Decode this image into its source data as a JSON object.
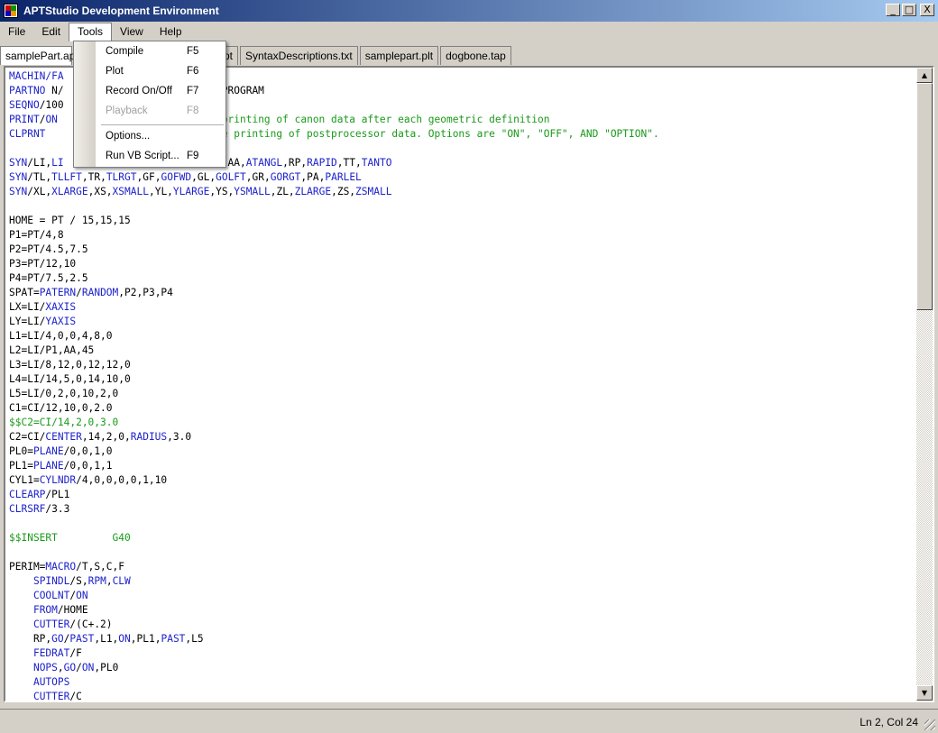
{
  "window": {
    "title": "APTStudio Development Environment",
    "min": "_",
    "max": "□",
    "close": "X"
  },
  "menu": [
    "File",
    "Edit",
    "Tools",
    "View",
    "Help"
  ],
  "tabs": [
    "samplePart.apt",
    "pt",
    "SyntaxDescriptions.txt",
    "samplepart.plt",
    "dogbone.tap"
  ],
  "tools_menu": {
    "items": [
      {
        "label": "Compile",
        "shortcut": "F5",
        "enabled": true
      },
      {
        "label": "Plot",
        "shortcut": "F6",
        "enabled": true
      },
      {
        "label": "Record On/Off",
        "shortcut": "F7",
        "enabled": true
      },
      {
        "label": "Playback",
        "shortcut": "F8",
        "enabled": false
      },
      {
        "label": "Options...",
        "shortcut": "",
        "enabled": true
      },
      {
        "label": "Run VB Script...",
        "shortcut": "F9",
        "enabled": true
      }
    ]
  },
  "colors": {
    "keyword": "#1d22c9",
    "comment": "#1a9a1a",
    "text": "#000000"
  },
  "code_lines": [
    [
      [
        "MACHIN/FA",
        "k"
      ]
    ],
    [
      [
        "PARTNO",
        "k"
      ],
      [
        " N/",
        ""
      ],
      [
        "                          PROGRAM",
        ""
      ]
    ],
    [
      [
        "SEQNO",
        "k"
      ],
      [
        "/100",
        ""
      ]
    ],
    [
      [
        "PRINT",
        "k"
      ],
      [
        "/",
        ""
      ],
      [
        "ON",
        "k"
      ],
      [
        "                       ",
        ""
      ],
      [
        "the printing of canon data after each geometric definition",
        "c"
      ]
    ],
    [
      [
        "CLPRNT",
        "k"
      ],
      [
        "                           ",
        ""
      ],
      [
        "the printing of postprocessor data. Options are \"ON\", \"OFF\", AND \"OPTION\".",
        "c"
      ]
    ],
    [
      [
        "",
        ""
      ]
    ],
    [
      [
        "SYN",
        "k"
      ],
      [
        "/LI,",
        ""
      ],
      [
        "LI",
        "k"
      ],
      [
        "                           AA,",
        ""
      ],
      [
        "ATANGL",
        "k"
      ],
      [
        ",RP,",
        ""
      ],
      [
        "RAPID",
        "k"
      ],
      [
        ",TT,",
        ""
      ],
      [
        "TANTO",
        "k"
      ]
    ],
    [
      [
        "SYN",
        "k"
      ],
      [
        "/TL,",
        ""
      ],
      [
        "TLLFT",
        "k"
      ],
      [
        ",TR,",
        ""
      ],
      [
        "TLRGT",
        "k"
      ],
      [
        ",GF,",
        ""
      ],
      [
        "GOFWD",
        "k"
      ],
      [
        ",GL,",
        ""
      ],
      [
        "GOLFT",
        "k"
      ],
      [
        ",GR,",
        ""
      ],
      [
        "GORGT",
        "k"
      ],
      [
        ",PA,",
        ""
      ],
      [
        "PARLEL",
        "k"
      ]
    ],
    [
      [
        "SYN",
        "k"
      ],
      [
        "/XL,",
        ""
      ],
      [
        "XLARGE",
        "k"
      ],
      [
        ",XS,",
        ""
      ],
      [
        "XSMALL",
        "k"
      ],
      [
        ",YL,",
        ""
      ],
      [
        "YLARGE",
        "k"
      ],
      [
        ",YS,",
        ""
      ],
      [
        "YSMALL",
        "k"
      ],
      [
        ",ZL,",
        ""
      ],
      [
        "ZLARGE",
        "k"
      ],
      [
        ",ZS,",
        ""
      ],
      [
        "ZSMALL",
        "k"
      ]
    ],
    [
      [
        "",
        ""
      ]
    ],
    [
      [
        "HOME = PT / 15,15,15",
        ""
      ]
    ],
    [
      [
        "P1=PT/4,8",
        ""
      ]
    ],
    [
      [
        "P2=PT/4.5,7.5",
        ""
      ]
    ],
    [
      [
        "P3=PT/12,10",
        ""
      ]
    ],
    [
      [
        "P4=PT/7.5,2.5",
        ""
      ]
    ],
    [
      [
        "SPAT=",
        ""
      ],
      [
        "PATERN",
        "k"
      ],
      [
        "/",
        ""
      ],
      [
        "RANDOM",
        "k"
      ],
      [
        ",P2,P3,P4",
        ""
      ]
    ],
    [
      [
        "LX=LI/",
        ""
      ],
      [
        "XAXIS",
        "k"
      ]
    ],
    [
      [
        "LY=LI/",
        ""
      ],
      [
        "YAXIS",
        "k"
      ]
    ],
    [
      [
        "L1=LI/4,0,0,4,8,0",
        ""
      ]
    ],
    [
      [
        "L2=LI/P1,AA,45",
        ""
      ]
    ],
    [
      [
        "L3=LI/8,12,0,12,12,0",
        ""
      ]
    ],
    [
      [
        "L4=LI/14,5,0,14,10,0",
        ""
      ]
    ],
    [
      [
        "L5=LI/0,2,0,10,2,0",
        ""
      ]
    ],
    [
      [
        "C1=CI/12,10,0,2.0",
        ""
      ]
    ],
    [
      [
        "$$C2=CI/14,2,0,3.0",
        "c"
      ]
    ],
    [
      [
        "C2=CI/",
        ""
      ],
      [
        "CENTER",
        "k"
      ],
      [
        ",14,2,0,",
        ""
      ],
      [
        "RADIUS",
        "k"
      ],
      [
        ",3.0",
        ""
      ]
    ],
    [
      [
        "PL0=",
        ""
      ],
      [
        "PLANE",
        "k"
      ],
      [
        "/0,0,1,0",
        ""
      ]
    ],
    [
      [
        "PL1=",
        ""
      ],
      [
        "PLANE",
        "k"
      ],
      [
        "/0,0,1,1",
        ""
      ]
    ],
    [
      [
        "CYL1=",
        ""
      ],
      [
        "CYLNDR",
        "k"
      ],
      [
        "/4,0,0,0,0,1,10",
        ""
      ]
    ],
    [
      [
        "CLEARP",
        "k"
      ],
      [
        "/PL1",
        ""
      ]
    ],
    [
      [
        "CLRSRF",
        "k"
      ],
      [
        "/3.3",
        ""
      ]
    ],
    [
      [
        "",
        ""
      ]
    ],
    [
      [
        "$$INSERT         G40",
        "c"
      ]
    ],
    [
      [
        "",
        ""
      ]
    ],
    [
      [
        "PERIM=",
        ""
      ],
      [
        "MACRO",
        "k"
      ],
      [
        "/T,S,C,F",
        ""
      ]
    ],
    [
      [
        "    ",
        ""
      ],
      [
        "SPINDL",
        "k"
      ],
      [
        "/S,",
        ""
      ],
      [
        "RPM",
        "k"
      ],
      [
        ",",
        ""
      ],
      [
        "CLW",
        "k"
      ]
    ],
    [
      [
        "    ",
        ""
      ],
      [
        "COOLNT",
        "k"
      ],
      [
        "/",
        ""
      ],
      [
        "ON",
        "k"
      ]
    ],
    [
      [
        "    ",
        ""
      ],
      [
        "FROM",
        "k"
      ],
      [
        "/HOME",
        ""
      ]
    ],
    [
      [
        "    ",
        ""
      ],
      [
        "CUTTER",
        "k"
      ],
      [
        "/(C+.2)",
        ""
      ]
    ],
    [
      [
        "    RP,",
        ""
      ],
      [
        "GO",
        "k"
      ],
      [
        "/",
        ""
      ],
      [
        "PAST",
        "k"
      ],
      [
        ",L1,",
        ""
      ],
      [
        "ON",
        "k"
      ],
      [
        ",PL1,",
        ""
      ],
      [
        "PAST",
        "k"
      ],
      [
        ",L5",
        ""
      ]
    ],
    [
      [
        "    ",
        ""
      ],
      [
        "FEDRAT",
        "k"
      ],
      [
        "/F",
        ""
      ]
    ],
    [
      [
        "    ",
        ""
      ],
      [
        "NOPS",
        "k"
      ],
      [
        ",",
        ""
      ],
      [
        "GO",
        "k"
      ],
      [
        "/",
        ""
      ],
      [
        "ON",
        "k"
      ],
      [
        ",PL0",
        ""
      ]
    ],
    [
      [
        "    ",
        ""
      ],
      [
        "AUTOPS",
        "k"
      ]
    ],
    [
      [
        "    ",
        ""
      ],
      [
        "CUTTER",
        "k"
      ],
      [
        "/C",
        ""
      ]
    ]
  ],
  "status": {
    "position": "Ln 2, Col 24"
  }
}
